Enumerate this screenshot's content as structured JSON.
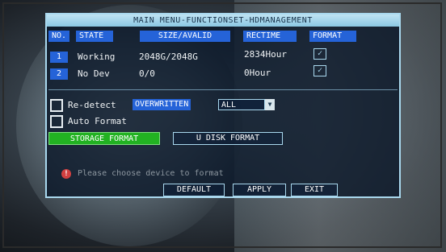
{
  "window": {
    "title": "MAIN MENU-FUNCTIONSET-HDMANAGEMENT"
  },
  "table": {
    "headers": {
      "no": "NO.",
      "state": "STATE",
      "size": "SIZE/AVALID",
      "rectime": "RECTIME",
      "format": "FORMAT"
    },
    "rows": [
      {
        "no": "1",
        "state": "Working",
        "size": "2048G/2048G",
        "rectime": "2834Hour",
        "format_checked": true
      },
      {
        "no": "2",
        "state": "No Dev",
        "size": "0/0",
        "rectime": "0Hour",
        "format_checked": true
      }
    ],
    "check_glyph": "✓"
  },
  "options": {
    "redetect_label": "Re-detect",
    "redetect_checked": false,
    "overwritten_label": "OVERWRITTEN",
    "overwritten_value": "ALL",
    "auto_format_label": "Auto Format",
    "auto_format_checked": false
  },
  "actions": {
    "storage_format": "STORAGE FORMAT",
    "u_disk_format": "U DISK FORMAT",
    "default": "DEFAULT",
    "apply": "APPLY",
    "exit": "EXIT"
  },
  "hint": {
    "icon": "info-icon",
    "text": "Please choose device to format"
  },
  "colors": {
    "accent_blue": "#2563d8",
    "frame": "#a9d8ee",
    "green_button": "#22b222",
    "warning_icon": "#d24040"
  }
}
